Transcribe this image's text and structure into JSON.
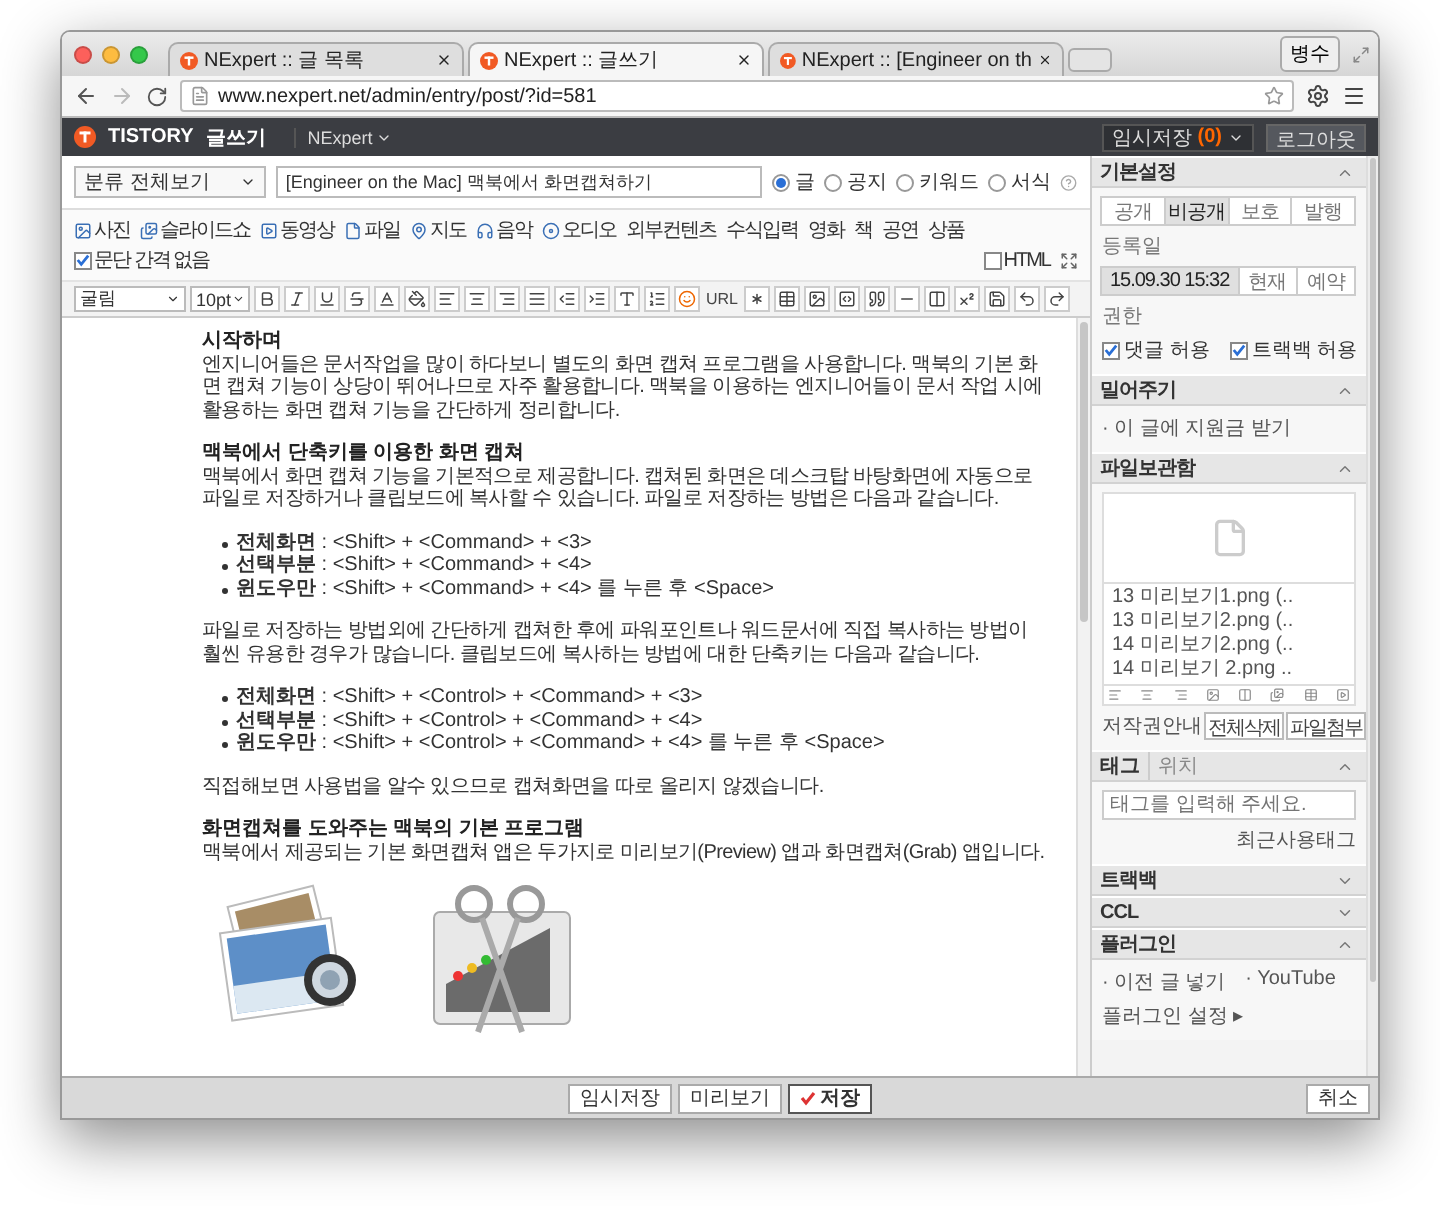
{
  "browser": {
    "tabs": [
      {
        "title": "NExpert :: 글 목록",
        "selected": false
      },
      {
        "title": "NExpert :: 글쓰기",
        "selected": true
      },
      {
        "title": "NExpert :: [Engineer on th",
        "selected": false
      }
    ],
    "profile": "병수",
    "url": "www.nexpert.net/admin/entry/post/?id=581"
  },
  "topbar": {
    "logo": "TISTORY",
    "section": "글쓰기",
    "blog": "NExpert",
    "drafts_label": "임시저장",
    "drafts_count": "(0)",
    "logout": "로그아웃"
  },
  "editor": {
    "category": "분류 전체보기",
    "title": "[Engineer on the Mac] 맥북에서 화면캡쳐하기",
    "types": [
      {
        "label": "글",
        "selected": true
      },
      {
        "label": "공지",
        "selected": false
      },
      {
        "label": "키워드",
        "selected": false
      },
      {
        "label": "서식",
        "selected": false
      }
    ],
    "insert_tools": [
      {
        "label": "사진",
        "kind": "photo"
      },
      {
        "label": "슬라이드쇼",
        "kind": "slideshow"
      },
      {
        "label": "동영상",
        "kind": "video"
      },
      {
        "label": "파일",
        "kind": "file"
      },
      {
        "label": "지도",
        "kind": "map"
      },
      {
        "label": "음악",
        "kind": "music"
      },
      {
        "label": "오디오",
        "kind": "audio"
      },
      {
        "label": "외부컨텐츠",
        "kind": "text"
      },
      {
        "label": "수식입력",
        "kind": "text"
      },
      {
        "label": "영화",
        "kind": "text"
      },
      {
        "label": "책",
        "kind": "text"
      },
      {
        "label": "공연",
        "kind": "text"
      },
      {
        "label": "상품",
        "kind": "text"
      }
    ],
    "paragraph_option": {
      "label": "문단 간격 없음",
      "checked": true
    },
    "html": {
      "label": "HTML",
      "checked": false
    },
    "font": "굴림",
    "size": "10pt",
    "link_label": "URL",
    "content": [
      {
        "kind": "heading",
        "text": "시작하며"
      },
      {
        "kind": "paragraph",
        "text": "엔지니어들은 문서작업을 많이 하다보니 별도의 화면 캡쳐 프로그램을 사용합니다. 맥북의 기본 화면 캡쳐 기능이 상당이 뛰어나므로 자주 활용합니다. 맥북을 이용하는 엔지니어들이 문서 작업 시에 활용하는 화면 캡쳐 기능을 간단하게 정리합니다."
      },
      {
        "kind": "heading",
        "text": "맥북에서 단축키를 이용한 화면 캡쳐"
      },
      {
        "kind": "paragraph",
        "text": "맥북에서 화면 캡쳐 기능을 기본적으로 제공합니다. 캡쳐된 화면은 데스크탑 바탕화면에 자동으로 파일로 저장하거나 클립보드에 복사할 수 있습니다. 파일로 저장하는 방법은 다음과 같습니다."
      },
      {
        "kind": "list",
        "items": [
          "**전체화면** : <Shift> + <Command> + <3>",
          "**선택부분** : <Shift> + <Command> + <4>",
          "**윈도우만** : <Shift> + <Command> + <4> 를 누른 후 <Space>"
        ]
      },
      {
        "kind": "paragraph",
        "text": "파일로 저장하는 방법외에 간단하게 캡쳐한 후에 파워포인트나 워드문서에 직접 복사하는 방법이 훨씬 유용한 경우가 많습니다. 클립보드에 복사하는 방법에 대한 단축키는 다음과 같습니다."
      },
      {
        "kind": "list",
        "items": [
          "**전체화면** : <Shift> + <Control> + <Command> + <3>",
          "**선택부분** : <Shift> + <Control> +  <Command> + <4>",
          "**윈도우만** : <Shift> + <Control> + <Command> + <4> 를 누른 후 <Space>"
        ]
      },
      {
        "kind": "paragraph",
        "text": "직접해보면 사용법을 알수 있으므로 캡쳐화면을 따로 올리지 않겠습니다."
      },
      {
        "kind": "heading",
        "text": "화면캡쳐를 도와주는 맥북의 기본 프로그램"
      },
      {
        "kind": "paragraph",
        "text": "맥북에서 제공되는 기본 화면캡쳐 앱은 두가지로 미리보기(Preview) 앱과 화면캡쳐(Grab) 앱입니다."
      }
    ]
  },
  "footer": {
    "buttons": [
      {
        "label": "임시저장",
        "primary": false
      },
      {
        "label": "미리보기",
        "primary": false
      },
      {
        "label": "저장",
        "primary": true
      }
    ],
    "cancel": "취소"
  },
  "sidebar": {
    "settings": {
      "title": "기본설정",
      "expanded": true,
      "visibility": [
        {
          "label": "공개",
          "selected": false
        },
        {
          "label": "비공개",
          "selected": true
        },
        {
          "label": "보호",
          "selected": false
        },
        {
          "label": "발행",
          "selected": false
        }
      ],
      "date_label": "등록일",
      "dates": [
        {
          "label": "15.09.30 15:32",
          "selected": true
        },
        {
          "label": "현재",
          "selected": false
        },
        {
          "label": "예약",
          "selected": false
        }
      ],
      "permission_label": "권한",
      "permissions": [
        {
          "label": "댓글 허용",
          "checked": true
        },
        {
          "label": "트랙백 허용",
          "checked": true
        }
      ]
    },
    "support": {
      "title": "밀어주기",
      "expanded": true,
      "item": "· 이 글에 지원금 받기"
    },
    "files": {
      "title": "파일보관함",
      "expanded": true,
      "items": [
        "13 미리보기1.png (..",
        "13 미리보기2.png (..",
        "14 미리보기2.png (..",
        "14 미리보기 2.png .."
      ],
      "copyright": "저작권안내",
      "delete_all": "전체삭제",
      "attach": "파일첨부"
    },
    "tags": {
      "tabs": [
        {
          "label": "태그",
          "selected": true
        },
        {
          "label": "위치",
          "selected": false
        }
      ],
      "expanded": true,
      "placeholder": "태그를 입력해 주세요.",
      "recent": "최근사용태그"
    },
    "trackback": {
      "title": "트랙백",
      "expanded": false
    },
    "ccl": {
      "title": "CCL",
      "expanded": false
    },
    "plugins": {
      "title": "플러그인",
      "expanded": true,
      "items": [
        "· 이전 글 넣기",
        "· YouTube"
      ],
      "settings": "플러그인 설정 ▸"
    }
  }
}
